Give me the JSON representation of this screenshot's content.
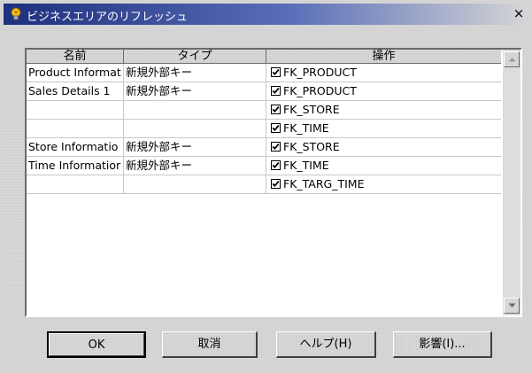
{
  "window": {
    "title": "ビジネスエリアのリフレッシュ",
    "close_label": "×",
    "icon": "app-bulb-icon"
  },
  "table": {
    "columns": [
      "名前",
      "タイプ",
      "操作"
    ],
    "rows": [
      {
        "name": "Product Informat",
        "type": "新規外部キー",
        "action": "FK_PRODUCT",
        "checked": true
      },
      {
        "name": "Sales Details 1",
        "type": "新規外部キー",
        "action": "FK_PRODUCT",
        "checked": true
      },
      {
        "name": "",
        "type": "",
        "action": "FK_STORE",
        "checked": true
      },
      {
        "name": "",
        "type": "",
        "action": "FK_TIME",
        "checked": true
      },
      {
        "name": "Store Informatio",
        "type": "新規外部キー",
        "action": "FK_STORE",
        "checked": true
      },
      {
        "name": "Time Informatior",
        "type": "新規外部キー",
        "action": "FK_TIME",
        "checked": true
      },
      {
        "name": "",
        "type": "",
        "action": "FK_TARG_TIME",
        "checked": true
      }
    ]
  },
  "buttons": {
    "ok": "OK",
    "cancel": "取消",
    "help": "ヘルプ(H)",
    "impact": "影響(I)..."
  }
}
